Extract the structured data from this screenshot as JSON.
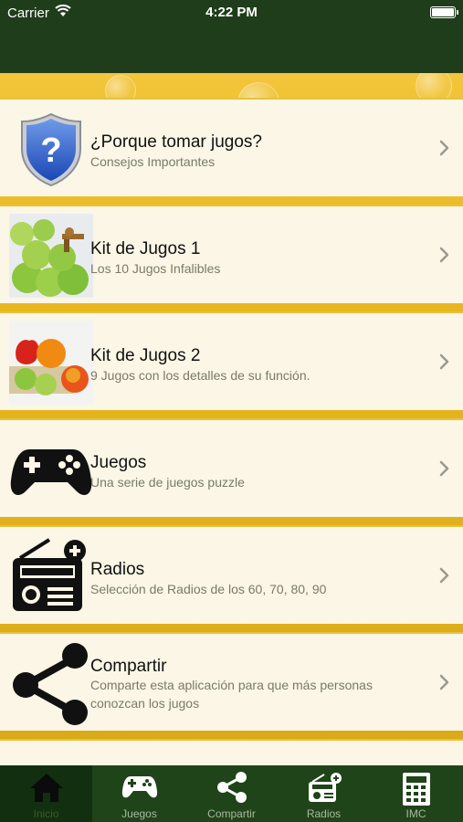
{
  "status_bar": {
    "carrier": "Carrier",
    "time": "4:22 PM"
  },
  "menu": {
    "items": [
      {
        "title": "¿Porque tomar jugos?",
        "subtitle": "Consejos Importantes",
        "icon": "shield-question-icon"
      },
      {
        "title": "Kit de Jugos 1",
        "subtitle": "Los 10 Jugos Infalibles",
        "icon": "apples-photo"
      },
      {
        "title": "Kit de Jugos 2",
        "subtitle": "9 Jugos con los detalles de su función.",
        "icon": "fruits-photo"
      },
      {
        "title": "Juegos",
        "subtitle": "Una serie de juegos puzzle",
        "icon": "gamepad-icon"
      },
      {
        "title": "Radios",
        "subtitle": "Selección de Radios de los 60, 70, 80, 90",
        "icon": "radio-icon"
      },
      {
        "title": "Compartir",
        "subtitle": "Comparte esta aplicación para que más personas conozcan los jugos",
        "icon": "share-icon"
      }
    ]
  },
  "tab_bar": {
    "active": "Inicio",
    "tabs": [
      {
        "label": "Inicio",
        "icon": "home-icon"
      },
      {
        "label": "Juegos",
        "icon": "gamepad-icon"
      },
      {
        "label": "Compartir",
        "icon": "share-icon"
      },
      {
        "label": "Radios",
        "icon": "radio-icon"
      },
      {
        "label": "IMC",
        "icon": "calculator-icon"
      }
    ]
  },
  "colors": {
    "header": "#1f3d1a",
    "tabbar": "#1f4419",
    "row_bg": "#fbf6e5",
    "accent": "#e6c23c"
  }
}
